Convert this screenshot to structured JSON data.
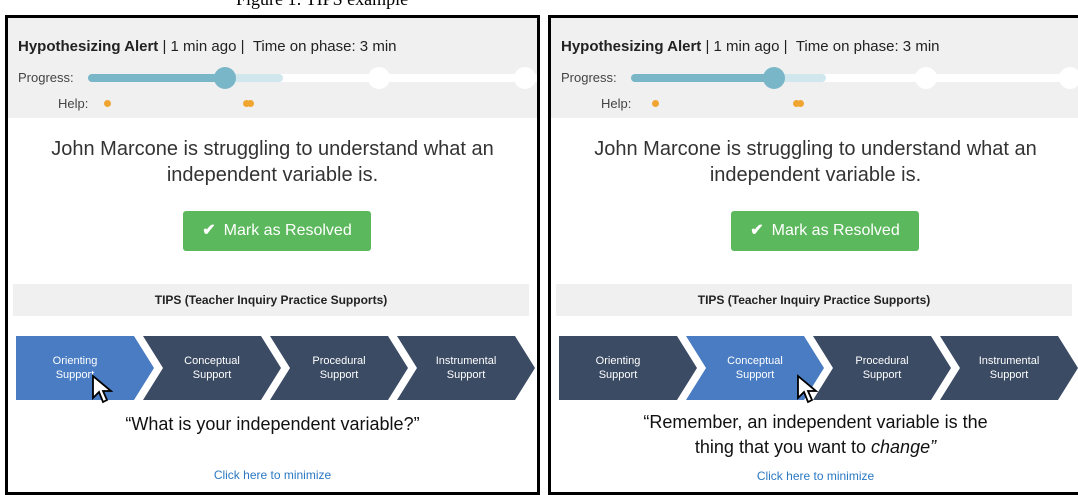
{
  "figure_caption_fragment": "Figure 1: TIPS example",
  "panels": [
    {
      "alert_type": "Hypothesizing Alert",
      "time_ago": "1 min ago",
      "time_on_phase": "Time on phase: 3 min",
      "progress_label": "Progress:",
      "help_label": "Help:",
      "message": "John Marcone is struggling to understand what an independent variable is.",
      "resolve_label": "Mark as Resolved",
      "tips_label": "TIPS (Teacher Inquiry Practice Supports)",
      "supports": [
        "Orienting\nSupport",
        "Conceptual\nSupport",
        "Procedural\nSupport",
        "Instrumental\nSupport"
      ],
      "active_support_index": 0,
      "quote": "“What is your independent variable?”",
      "minimize_link": "Click here to minimize"
    },
    {
      "alert_type": "Hypothesizing Alert",
      "time_ago": "1 min ago",
      "time_on_phase": "Time on phase: 3 min",
      "progress_label": "Progress:",
      "help_label": "Help:",
      "message": "John Marcone is struggling to understand what an independent variable is.",
      "resolve_label": "Mark as Resolved",
      "tips_label": "TIPS (Teacher Inquiry Practice Supports)",
      "supports": [
        "Orienting\nSupport",
        "Conceptual\nSupport",
        "Procedural\nSupport",
        "Instrumental\nSupport"
      ],
      "active_support_index": 1,
      "quote_line1": "“Remember, an independent variable is the",
      "quote_line2_prefix": "thing that you want to ",
      "quote_line2_emph": "change",
      "quote_line2_suffix": "”",
      "minimize_link": "Click here to minimize"
    }
  ],
  "colors": {
    "active_chevron": "#4a7cc4",
    "inactive_chevron": "#3a4b63",
    "progress_fill": "#79b6c7",
    "help_dot": "#f0a530",
    "resolve_button": "#5cb85c",
    "link": "#2a78c2"
  }
}
